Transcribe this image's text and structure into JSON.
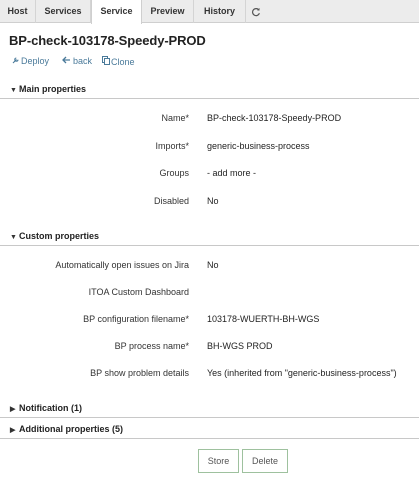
{
  "tabs": [
    {
      "label": "Host"
    },
    {
      "label": "Services"
    },
    {
      "label": "Service"
    },
    {
      "label": "Preview"
    },
    {
      "label": "History"
    }
  ],
  "refresh_icon": "refresh-icon",
  "title": "BP-check-103178-Speedy-PROD",
  "actions": {
    "deploy": "Deploy",
    "back": "back",
    "clone": "Clone"
  },
  "sections": {
    "main": "Main properties",
    "custom": "Custom properties",
    "notification": "Notification (1)",
    "additional": "Additional properties (5)"
  },
  "main_fields": [
    {
      "label": "Name*",
      "value": "BP-check-103178-Speedy-PROD"
    },
    {
      "label": "Imports*",
      "value": "generic-business-process"
    },
    {
      "label": "Groups",
      "value": "- add more -"
    },
    {
      "label": "Disabled",
      "value": "No"
    }
  ],
  "custom_fields": [
    {
      "label": "Automatically open issues on Jira",
      "value": "No"
    },
    {
      "label": "ITOA Custom Dashboard",
      "value": ""
    },
    {
      "label": "BP configuration filename*",
      "value": "103178-WUERTH-BH-WGS"
    },
    {
      "label": "BP process name*",
      "value": "BH-WGS PROD"
    },
    {
      "label": "BP show problem details",
      "value": "Yes (inherited from \"generic-business-process\")"
    }
  ],
  "buttons": {
    "store": "Store",
    "delete": "Delete"
  },
  "colors": {
    "link": "#4a7a9a",
    "button_border": "#9ec19e",
    "tabbar": "#ececec"
  }
}
